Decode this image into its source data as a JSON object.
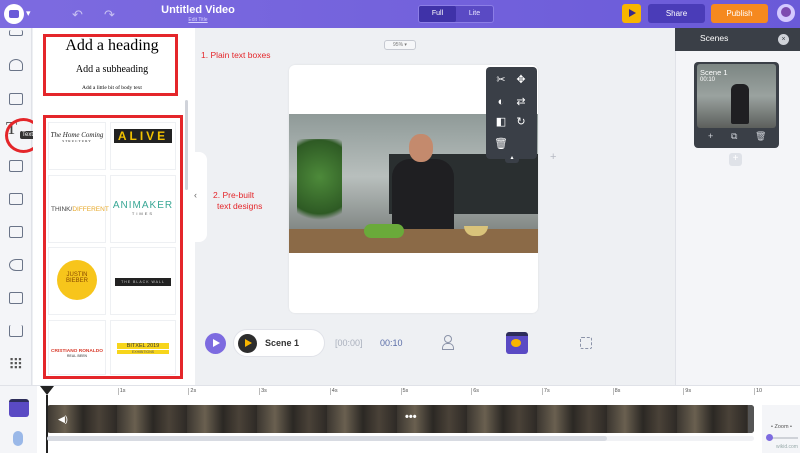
{
  "topbar": {
    "title": "Untitled Video",
    "subtitle": "Edit Title",
    "view_full": "Full",
    "view_lite": "Lite",
    "share": "Share",
    "publish": "Publish"
  },
  "rail": {
    "tooltip": "Text",
    "text_glyph": "T"
  },
  "library": {
    "heading": "Add a heading",
    "subheading": "Add a subheading",
    "body": "Add a little bit of body text",
    "designs": {
      "home_coming": "The Home Coming",
      "home_coming_sub": "STRUCTURY",
      "alive": "ALIVE",
      "think": "THINK",
      "different": "DIFFERENT",
      "animaker": "ANIMAKER",
      "animaker_sub": "TIMES",
      "justin": "JUSTIN",
      "bieber": "BIEBER",
      "black_text": "THE BLACK WALL",
      "cristiano": "CRISTIANO RONALDO",
      "cristiano_sub": "REAL BEEN",
      "bitxel": "BITXEL 2019",
      "bitxel_sub": "EXHIBITIONS"
    }
  },
  "annotations": {
    "plain": "1. Plain text boxes",
    "prebuilt_line1": "2. Pre-built",
    "prebuilt_line2": "text designs"
  },
  "canvas": {
    "zoom": "95%",
    "collapse": "‹"
  },
  "player": {
    "scene_label": "Scene 1",
    "time_current": "[00:00]",
    "time_total": "00:10"
  },
  "scenes_panel": {
    "title": "Scenes",
    "close": "×",
    "scene_name": "Scene 1",
    "scene_time": "00:10",
    "add": "+"
  },
  "timeline": {
    "ticks": [
      "1s",
      "2s",
      "3s",
      "4s",
      "5s",
      "6s",
      "7s",
      "8s",
      "9s",
      "10"
    ],
    "zoom_label": "Zoom"
  },
  "watermark": "wikid.com",
  "colors": {
    "brand": "#6a5ad8",
    "publish": "#f5891f",
    "annotation": "#e4262a"
  }
}
